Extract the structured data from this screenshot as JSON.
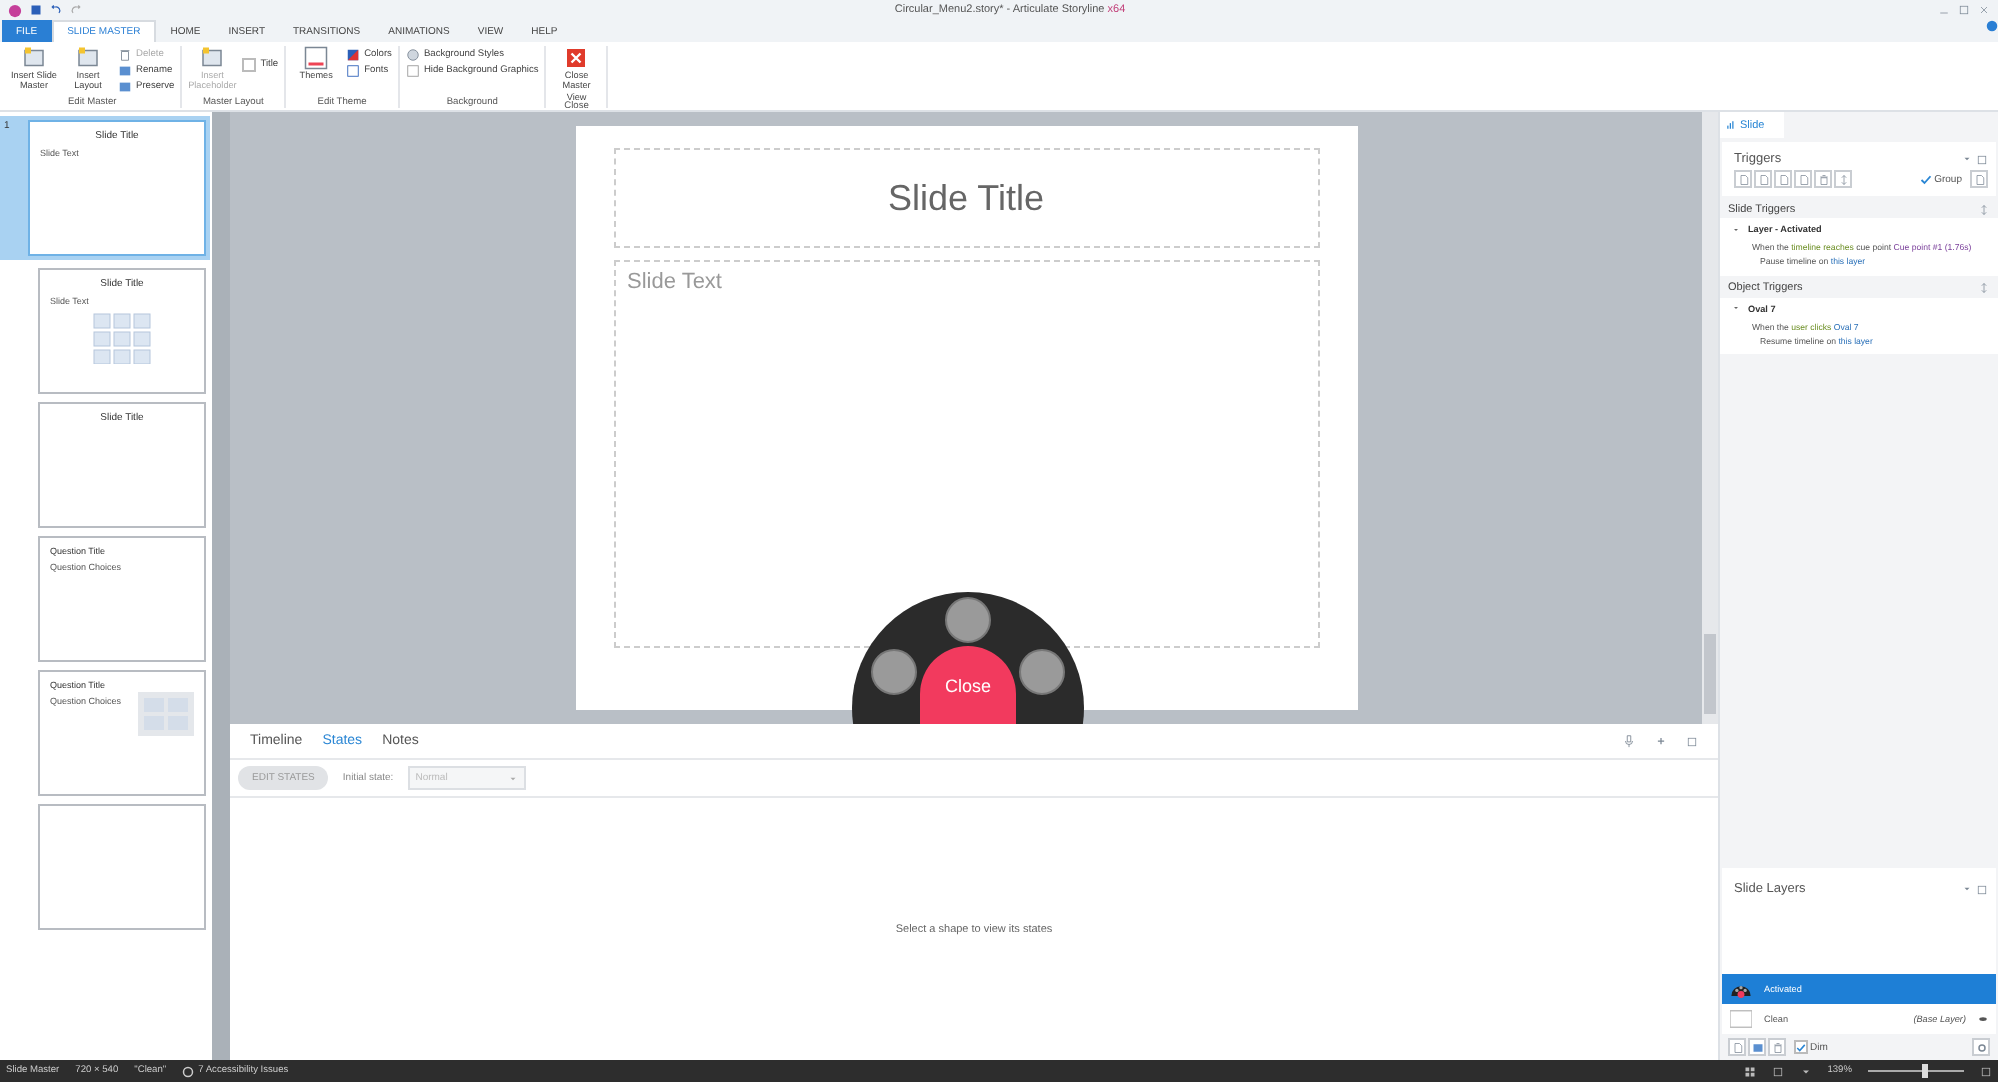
{
  "window": {
    "title": "Circular_Menu2.story* - Articulate Storyline",
    "edition": "x64"
  },
  "ribbon_tabs": [
    {
      "label": "FILE",
      "kind": "file",
      "selected": false
    },
    {
      "label": "SLIDE MASTER",
      "kind": "tab",
      "selected": true
    },
    {
      "label": "HOME",
      "kind": "tab",
      "selected": false
    },
    {
      "label": "INSERT",
      "kind": "tab",
      "selected": false
    },
    {
      "label": "TRANSITIONS",
      "kind": "tab",
      "selected": false
    },
    {
      "label": "ANIMATIONS",
      "kind": "tab",
      "selected": false
    },
    {
      "label": "VIEW",
      "kind": "tab",
      "selected": false
    },
    {
      "label": "HELP",
      "kind": "tab",
      "selected": false
    }
  ],
  "ribbon_groups": [
    {
      "label": "Edit Master",
      "items": [
        {
          "kind": "large",
          "label": "Insert Slide Master",
          "disabled": false
        },
        {
          "kind": "large",
          "label": "Insert Layout",
          "disabled": false
        },
        {
          "kind": "stack",
          "entries": [
            {
              "label": "Delete",
              "disabled": true
            },
            {
              "label": "Rename",
              "disabled": false
            },
            {
              "label": "Preserve",
              "disabled": false
            }
          ]
        }
      ]
    },
    {
      "label": "Master Layout",
      "items": [
        {
          "kind": "large",
          "label": "Insert Placeholder",
          "disabled": true
        },
        {
          "kind": "check",
          "label": "Title",
          "checked": false
        }
      ]
    },
    {
      "label": "Edit Theme",
      "items": [
        {
          "kind": "large",
          "label": "Themes",
          "disabled": false
        },
        {
          "kind": "stack",
          "entries": [
            {
              "label": "Colors",
              "disabled": false
            },
            {
              "label": "Fonts",
              "disabled": false
            }
          ]
        }
      ]
    },
    {
      "label": "Background",
      "items": [
        {
          "kind": "stack",
          "entries": [
            {
              "label": "Background Styles",
              "disabled": false
            },
            {
              "label": "Hide Background Graphics",
              "disabled": false
            }
          ]
        }
      ]
    },
    {
      "label": "Close",
      "items": [
        {
          "kind": "large",
          "label": "Close Master View",
          "disabled": false
        }
      ]
    }
  ],
  "slides": [
    {
      "number": "1",
      "selected": true,
      "kind": "title_text",
      "title": "Slide Title",
      "text": "Slide Text"
    },
    {
      "selected": false,
      "kind": "content",
      "title": "Slide Title",
      "text": "Slide Text"
    },
    {
      "selected": false,
      "kind": "title_only",
      "title": "Slide Title"
    },
    {
      "selected": false,
      "kind": "question",
      "title": "Question Title",
      "text": "Question Choices"
    },
    {
      "selected": false,
      "kind": "question_media",
      "title": "Question Title",
      "text": "Question Choices"
    },
    {
      "selected": false,
      "kind": "blank"
    }
  ],
  "slide": {
    "title_placeholder": "Slide Title",
    "text_placeholder": "Slide Text",
    "menu_close": "Close"
  },
  "bottom_panel": {
    "tabs": [
      {
        "label": "Timeline",
        "selected": false
      },
      {
        "label": "States",
        "selected": true
      },
      {
        "label": "Notes",
        "selected": false
      }
    ],
    "edit_states": "EDIT STATES",
    "initial_state_label": "Initial state:",
    "initial_state": "Normal",
    "message": "Select a shape to view its states"
  },
  "right_panel": {
    "tab": "Slide",
    "triggers_title": "Triggers",
    "group_label": "Group",
    "group_checked": true,
    "sections": [
      {
        "title": "Slide Triggers",
        "items": [
          {
            "name": "Layer - Activated",
            "expanded": true,
            "condition": [
              {
                "kind": "plain",
                "text": "When the"
              },
              {
                "kind": "event",
                "text": "timeline reaches"
              },
              {
                "kind": "plain",
                "text": "cue point"
              },
              {
                "kind": "value",
                "text": "Cue point #1 (1.76s)"
              }
            ],
            "action": [
              {
                "kind": "plain",
                "text": "Pause timeline on"
              },
              {
                "kind": "link",
                "text": "this layer"
              }
            ]
          }
        ]
      },
      {
        "title": "Object Triggers",
        "items": [
          {
            "name": "Oval 7",
            "expanded": true,
            "condition": [
              {
                "kind": "plain",
                "text": "When the"
              },
              {
                "kind": "event",
                "text": "user clicks"
              },
              {
                "kind": "link",
                "text": "Oval 7"
              }
            ],
            "action": [
              {
                "kind": "plain",
                "text": "Resume timeline on"
              },
              {
                "kind": "link",
                "text": "this layer"
              }
            ]
          }
        ]
      }
    ]
  },
  "layers": {
    "title": "Slide Layers",
    "items": [
      {
        "name": "Activated",
        "kind": "layer",
        "selected": true
      },
      {
        "name": "Clean",
        "kind": "base",
        "note": "(Base Layer)",
        "selected": false
      }
    ],
    "dim_label": "Dim",
    "dim_checked": true
  },
  "status_bar": {
    "items": [
      "Slide Master",
      "720 × 540",
      "\"Clean\""
    ],
    "accessibility": "7 Accessibility Issues",
    "zoom": "139%",
    "zoom_slider": {
      "level": 0.6
    }
  }
}
